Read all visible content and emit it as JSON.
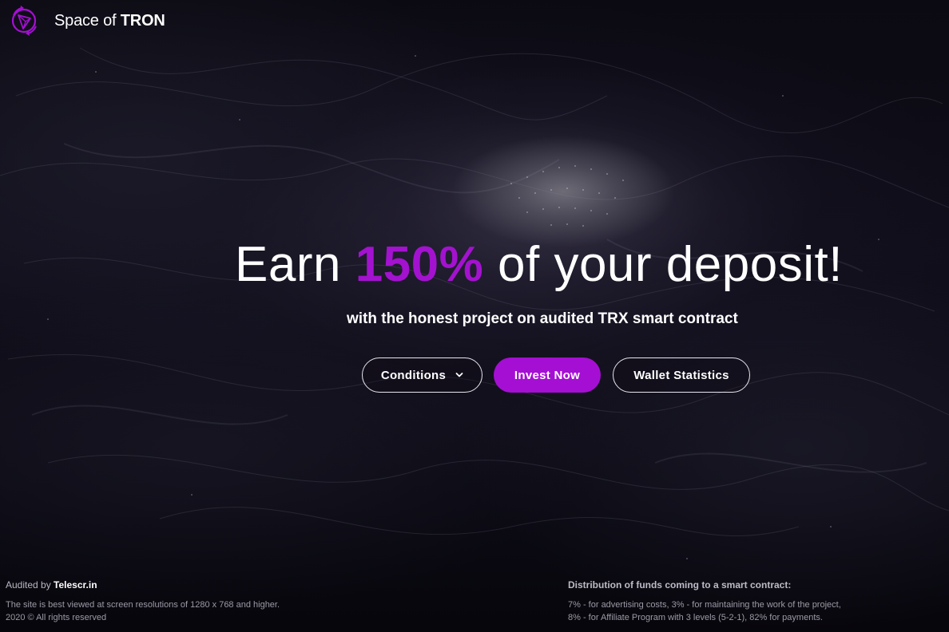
{
  "header": {
    "brand_prefix": "Space of ",
    "brand_strong": "TRON",
    "logo_icon": "tron-space-logo-icon",
    "accent_color": "#a50fd3"
  },
  "hero": {
    "title_before": "Earn ",
    "title_accent": "150%",
    "title_after": " of your deposit!",
    "subtitle": "with the honest project on audited TRX smart contract"
  },
  "actions": {
    "conditions_label": "Conditions",
    "conditions_icon": "chevron-down-icon",
    "invest_label": "Invest Now",
    "wallet_label": "Wallet Statistics"
  },
  "footer": {
    "audited_prefix": "Audited by ",
    "auditor": "Telescr.in",
    "resolution_note": "The site is best viewed at screen resolutions of 1280 x 768 and higher.",
    "copyright": "2020 © All rights reserved",
    "distribution_heading": "Distribution of funds coming to a smart contract:",
    "distribution_line1": "7% - for advertising costs, 3% - for maintaining the work of the project,",
    "distribution_line2": "8% - for Affiliate Program with 3 levels (5-2-1), 82% for payments."
  }
}
